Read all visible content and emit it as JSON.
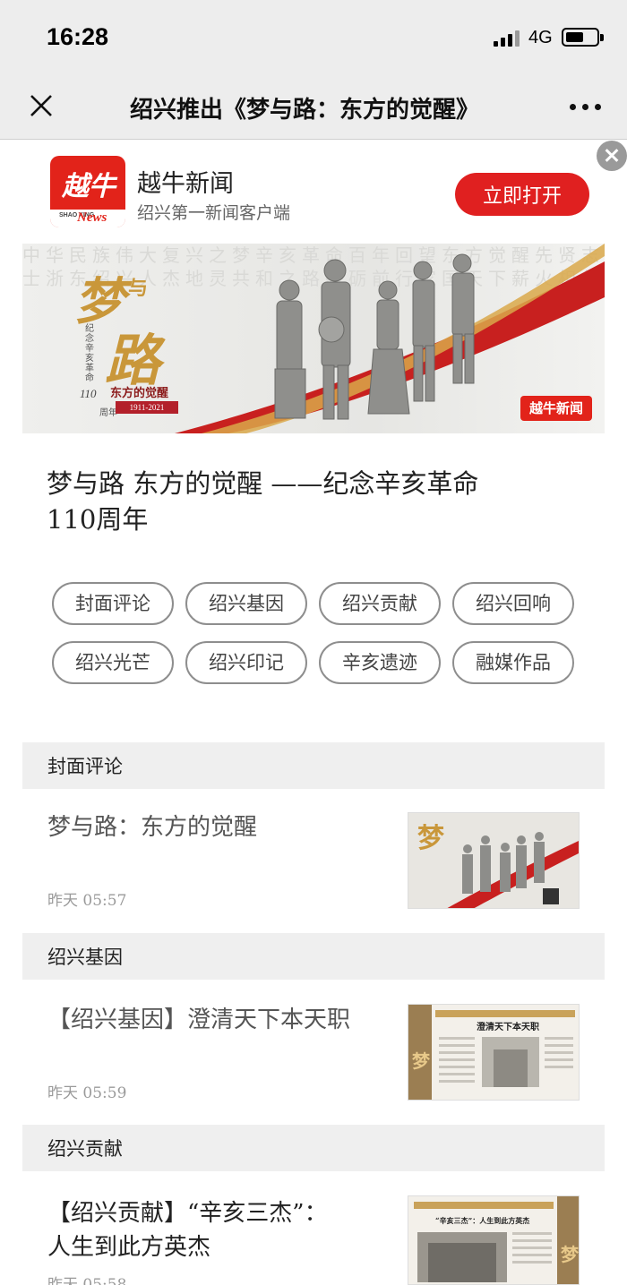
{
  "status_bar": {
    "time": "16:28",
    "network": "4G",
    "battery_level": 0.6
  },
  "nav": {
    "title": "绍兴推出《梦与路：东方的觉醒》",
    "close_icon": "close-icon",
    "more_icon": "more-dots-icon"
  },
  "app_banner": {
    "logo_text": "越牛",
    "logo_sub": "SHAO XING",
    "logo_news": "News",
    "app_name": "越牛新闻",
    "app_desc": "绍兴第一新闻客户端",
    "open_button": "立即打开",
    "accent_color": "#e02020"
  },
  "hero": {
    "title_1": "梦",
    "title_2": "与",
    "title_3": "路",
    "vertical_text": "纪念辛亥革命",
    "anniversary_num": "110",
    "anniversary_unit": "周年",
    "subtitle": "东方的觉醒",
    "dates": "1911-2021",
    "badge": "越牛新闻"
  },
  "headline": {
    "line_1": "梦与路  东方的觉醒  ——纪念辛亥革命",
    "line_2": "110周年"
  },
  "tags": [
    {
      "label": "封面评论"
    },
    {
      "label": "绍兴基因"
    },
    {
      "label": "绍兴贡献"
    },
    {
      "label": "绍兴回响"
    },
    {
      "label": "绍兴光芒"
    },
    {
      "label": "绍兴印记"
    },
    {
      "label": "辛亥遗迹"
    },
    {
      "label": "融媒作品"
    }
  ],
  "sections": [
    {
      "header": "封面评论",
      "article_title": "梦与路：东方的觉醒",
      "article_time": "昨天  05:57"
    },
    {
      "header": "绍兴基因",
      "article_title": "【绍兴基因】澄清天下本天职",
      "article_time": "昨天  05:59",
      "thumb_heading": "澄清天下本天职"
    },
    {
      "header": "绍兴贡献",
      "article_title_1": "【绍兴贡献】“辛亥三杰”：",
      "article_title_2": "人生到此方英杰",
      "article_time": "昨天  05:58",
      "thumb_heading": "“辛亥三杰”：人生到此方英杰"
    }
  ]
}
